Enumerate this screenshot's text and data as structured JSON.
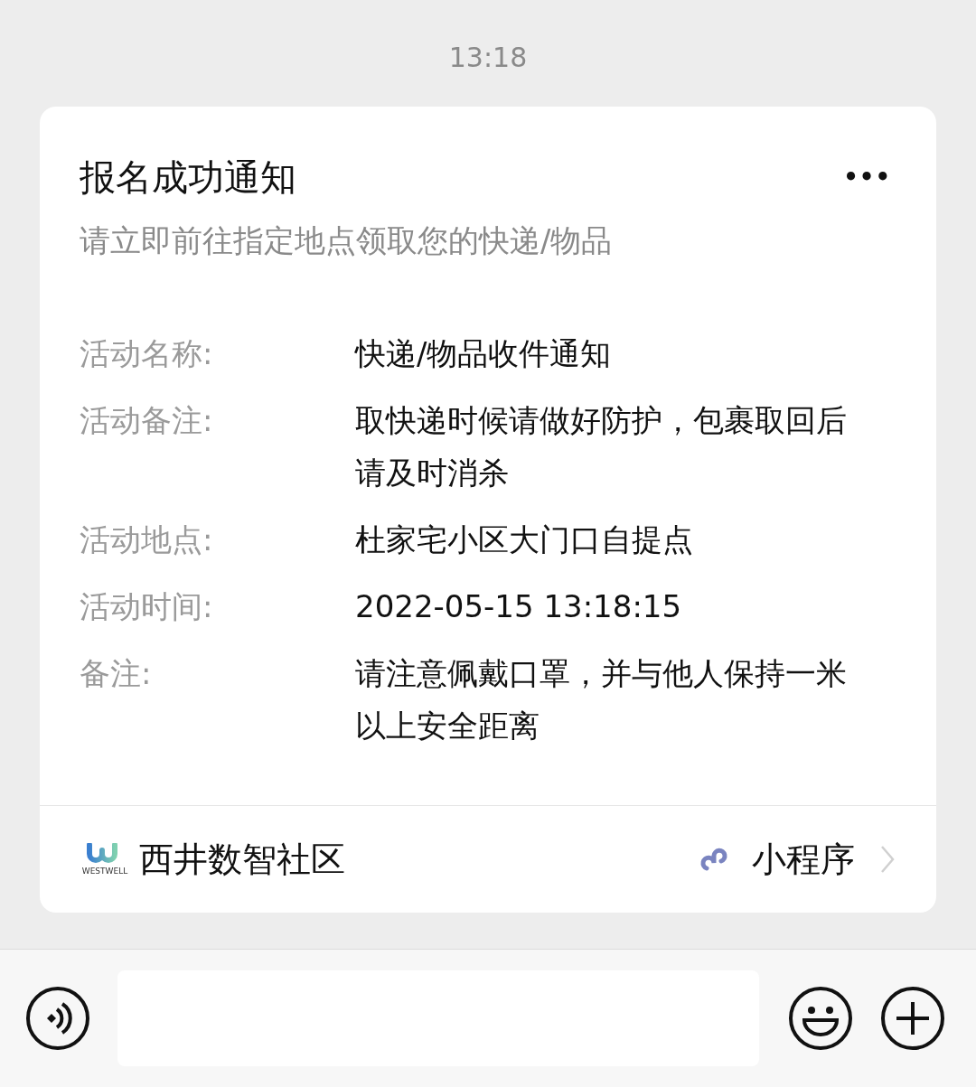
{
  "timestamp": "13:18",
  "card": {
    "title": "报名成功通知",
    "more": "•••",
    "subtitle": "请立即前往指定地点领取您的快递/物品",
    "fields": [
      {
        "label": "活动名称:",
        "value": "快递/物品收件通知"
      },
      {
        "label": "活动备注:",
        "value": "取快递时候请做好防护，包裹取回后请及时消杀"
      },
      {
        "label": "活动地点:",
        "value": "杜家宅小区大门口自提点"
      },
      {
        "label": "活动时间:",
        "value": "2022-05-15 13:18:15"
      },
      {
        "label": "备注:",
        "value": "请注意佩戴口罩，并与他人保持一米以上安全距离"
      }
    ],
    "footer": {
      "logo_caption": "WESTWELL",
      "source": "西井数智社区",
      "type": "小程序"
    }
  },
  "input_bar": {
    "buttons": [
      {
        "kind": "voice"
      },
      {
        "kind": "emoji"
      },
      {
        "kind": "plus"
      }
    ]
  }
}
